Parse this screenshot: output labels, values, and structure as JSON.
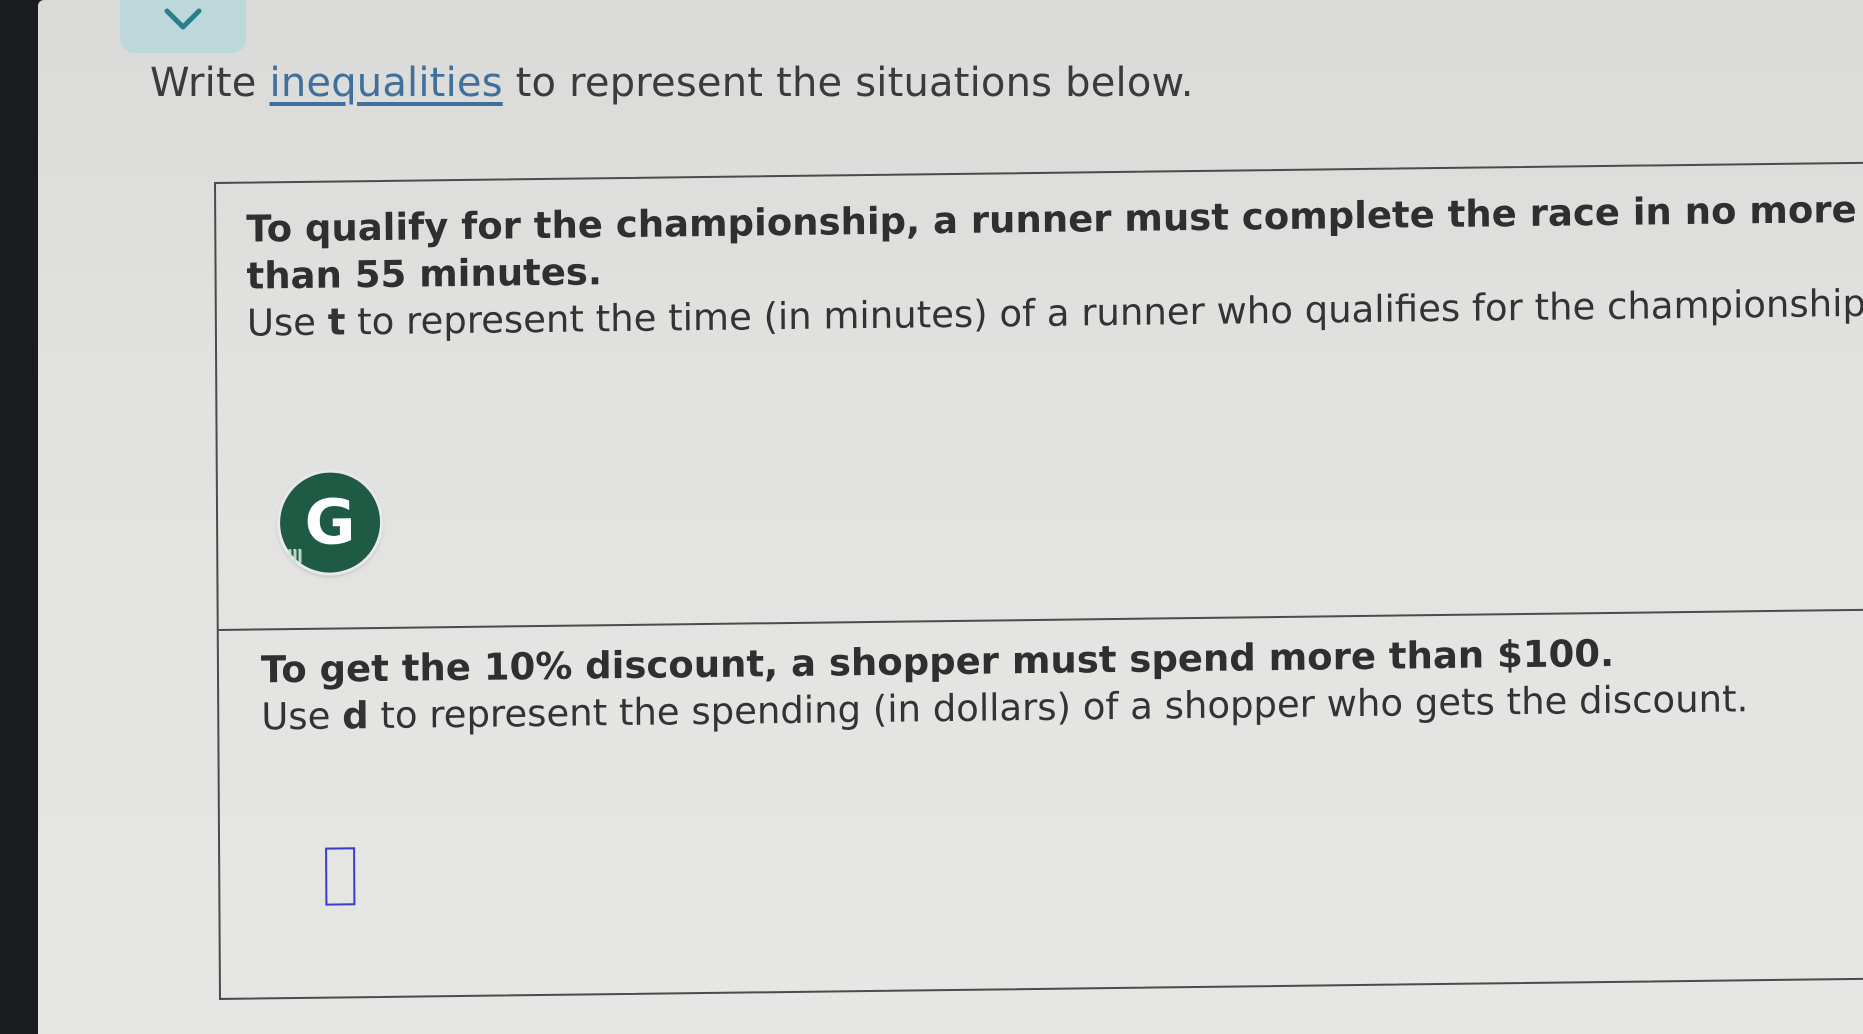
{
  "header": {
    "instruction_before": "Write",
    "instruction_link": "inequalities",
    "instruction_after": "to represent the situations below."
  },
  "problems": [
    {
      "statement": "To qualify for the championship, a runner must complete the race in no more than 55 minutes.",
      "prompt_before": "Use",
      "variable": "t",
      "prompt_after": "to represent the time (in minutes) of a runner who qualifies for the championship."
    },
    {
      "statement": "To get the 10% discount, a shopper must spend more than $100.",
      "prompt_before": "Use",
      "variable": "d",
      "prompt_after": "to represent the spending (in dollars) of a shopper who gets the discount."
    }
  ],
  "badge": {
    "letter": "G",
    "icon": "grammarly-icon"
  },
  "colors": {
    "badge_bg": "#1e5a44",
    "link": "#3f6f9c",
    "input_border": "#3a3acc",
    "tab_bg": "#bcd8da"
  }
}
